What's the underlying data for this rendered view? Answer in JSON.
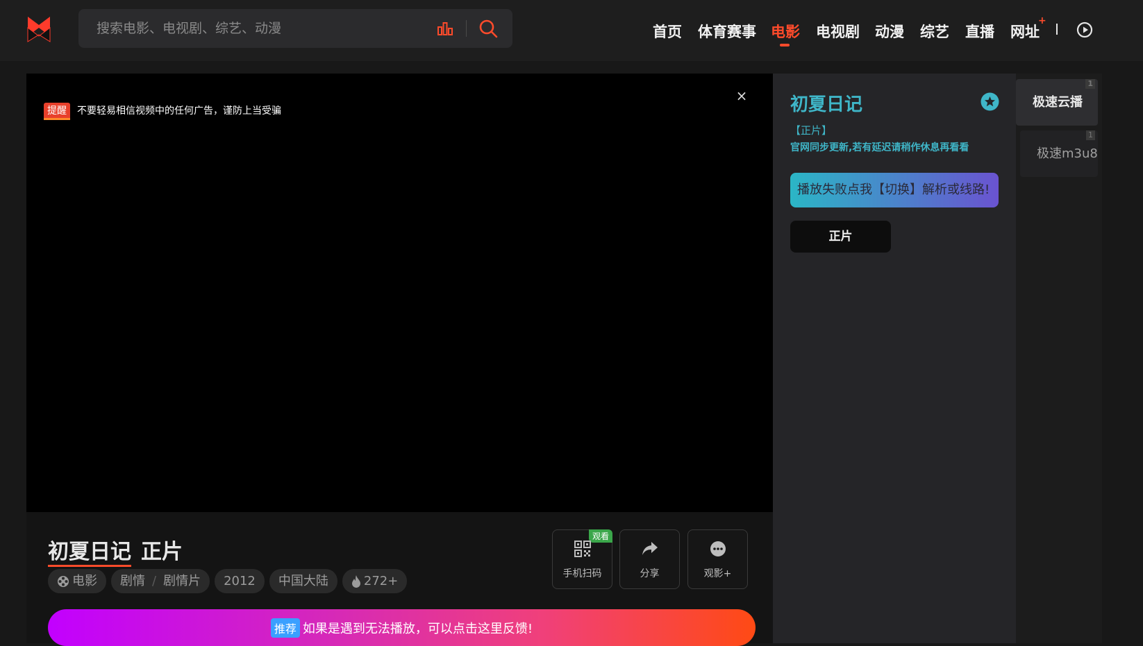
{
  "header": {
    "search": {
      "placeholder": "搜索电影、电视剧、综艺、动漫"
    },
    "nav": [
      {
        "label": "首页"
      },
      {
        "label": "体育赛事"
      },
      {
        "label": "电影",
        "active": true
      },
      {
        "label": "电视剧"
      },
      {
        "label": "动漫"
      },
      {
        "label": "综艺"
      },
      {
        "label": "直播"
      },
      {
        "label": "网址"
      }
    ],
    "nav_plus": "+",
    "colors": {
      "accent": "#ff4b2b"
    }
  },
  "player": {
    "notice_badge": "提醒",
    "notice_text": "不要轻易相信视频中的任何广告，谨防上当受骗",
    "close": "×",
    "title": "初夏日记",
    "episode": "正片",
    "tags": {
      "type": "电影",
      "genre1": "剧情",
      "genre2": "剧情片",
      "year": "2012",
      "region": "中国大陆",
      "heat": "272+"
    },
    "actions": {
      "qr": "手机扫码",
      "qr_badge": "观看",
      "share": "分享",
      "more": "观影+"
    },
    "feedback_badge": "推荐",
    "feedback_text": "如果是遇到无法播放，可以点击这里反馈!"
  },
  "panel": {
    "title": "初夏日记",
    "episode_label": "【正片】",
    "episode_note": "官网同步更新,若有延迟请稍作休息再看看",
    "switch_label": "播放失败点我【切换】解析或线路!",
    "episode_button": "正片",
    "colors": {
      "title": "#3fb6c8"
    }
  },
  "sources": [
    {
      "label": "极速云播",
      "count": "1",
      "active": true
    },
    {
      "label": "极速m3u8",
      "count": "1",
      "active": false
    }
  ]
}
